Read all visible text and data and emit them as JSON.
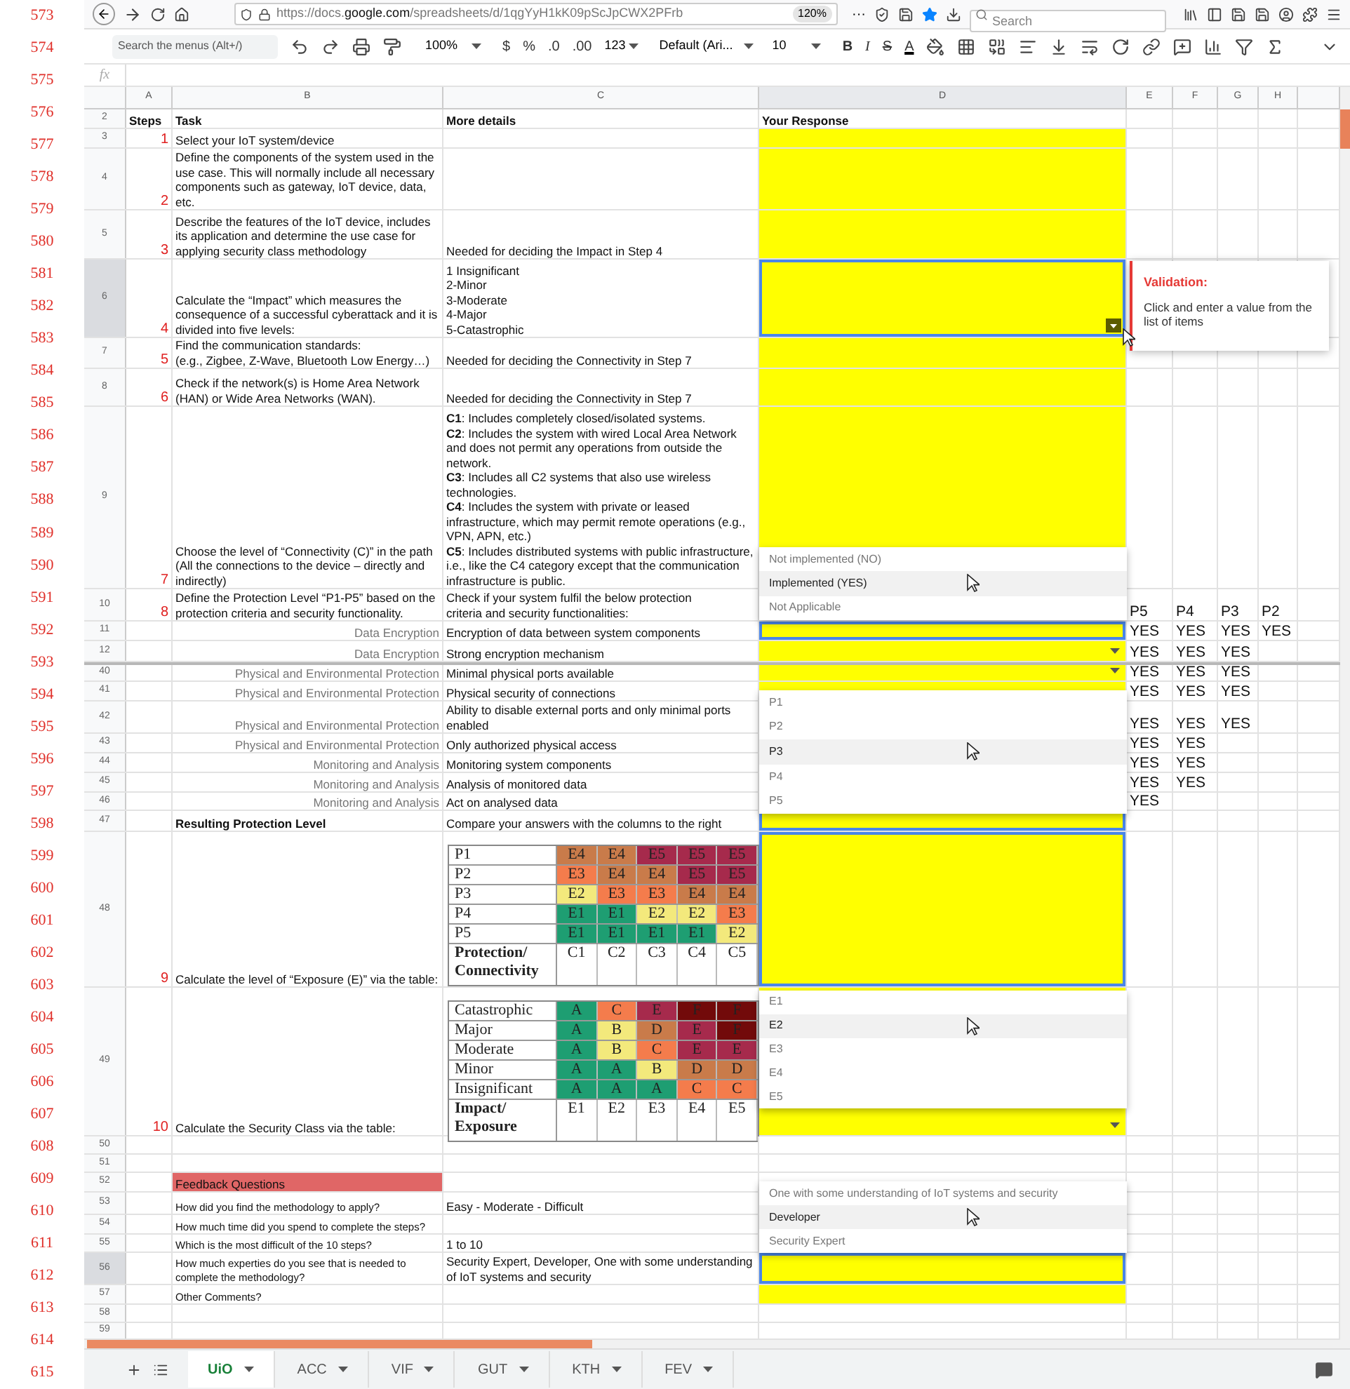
{
  "page_numbers": [
    "573",
    "574",
    "575",
    "576",
    "577",
    "578",
    "579",
    "580",
    "581",
    "582",
    "583",
    "584",
    "585",
    "586",
    "587",
    "588",
    "589",
    "590",
    "591",
    "592",
    "593",
    "594",
    "595",
    "596",
    "597",
    "598",
    "599",
    "600",
    "601",
    "602",
    "603",
    "604",
    "605",
    "606",
    "607",
    "608",
    "609",
    "610",
    "611",
    "612",
    "613",
    "614",
    "615"
  ],
  "browser": {
    "url_start": "https://docs.",
    "url_domain": "google.com",
    "url_rest": "/spreadsheets/d/1qgYyH1kK09pScJpCWX2PFrb",
    "zoom": "120%",
    "more": "···",
    "search": {
      "placeholder": "Search"
    }
  },
  "toolbar": {
    "menu_search": {
      "placeholder": "Search the menus (Alt+/)"
    },
    "zoom": "100%",
    "currency": "$",
    "percent": "%",
    "decimal_less": ".0",
    "decimal_more": ".00",
    "number_format": "123",
    "font": "Default (Ari...",
    "font_size": "10",
    "bold": "B",
    "italic": "I",
    "strike": "S",
    "text_color": "A"
  },
  "formula_bar": {
    "label": "fx"
  },
  "columns": [
    {
      "label": "A",
      "selected": false
    },
    {
      "label": "B",
      "selected": false
    },
    {
      "label": "C",
      "selected": false
    },
    {
      "label": "D",
      "selected": true
    },
    {
      "label": "E",
      "selected": false
    },
    {
      "label": "F",
      "selected": false
    },
    {
      "label": "G",
      "selected": false
    },
    {
      "label": "H",
      "selected": false
    }
  ],
  "rows": [
    {
      "num": "2",
      "kind": "header",
      "selected": false,
      "step": "Steps",
      "task": "Task",
      "details": "More details",
      "response": "Your Response",
      "yellow": false,
      "outlined": false
    },
    {
      "num": "3",
      "kind": "step",
      "selected": false,
      "step": "1",
      "task": "Select your IoT system/device",
      "yellow": true,
      "outlined": false
    },
    {
      "num": "4",
      "kind": "step",
      "selected": false,
      "step": "2",
      "task": "Define the components of the system used in the use case. This will normally include all necessary components such as gateway, IoT device, data, etc.",
      "yellow": true,
      "outlined": false
    },
    {
      "num": "5",
      "kind": "step",
      "selected": false,
      "step": "3",
      "task": "Describe the features of the IoT device, includes its application and determine the use case for applying security class methodology",
      "details": "Needed for deciding the Impact in Step 4",
      "yellow": true,
      "outlined": false
    },
    {
      "num": "6",
      "kind": "step",
      "selected": true,
      "step": "4",
      "task": "Calculate the “Impact” which measures the consequence of a successful cyberattack and it is divided into five levels:",
      "details": "1 Insignificant\n2-Minor\n3-Moderate\n4-Major\n5-Catastrophic",
      "yellow": true,
      "outlined": true,
      "arrow": true,
      "arrow_hovered": true
    },
    {
      "num": "7",
      "kind": "step",
      "selected": false,
      "step": "5",
      "task": "Find the communication standards:\n(e.g., Zigbee, Z-Wave, Bluetooth Low Energy…)",
      "details": "Needed for deciding the Connectivity in Step 7",
      "yellow": true,
      "outlined": false
    },
    {
      "num": "8",
      "kind": "step",
      "selected": false,
      "step": "6",
      "task": "Check if the network(s) is Home Area Network (HAN) or Wide Area Networks (WAN).",
      "details": "Needed for deciding the Connectivity in Step 7",
      "yellow": true,
      "outlined": false
    },
    {
      "num": "9",
      "kind": "step",
      "selected": false,
      "step": "7",
      "task": "Choose the level of “Connectivity (C)” in the path (All the connections to the device – directly and indirectly)",
      "details": "**C1**: Includes completely closed/isolated systems.\n**C2**: Includes the system with wired Local Area Network and does not permit any operations from outside the network.\n**C3**: Includes all C2 systems that also use wireless technologies.\n**C4**: Includes the system with private or leased infrastructure, which may permit remote operations (e.g., VPN, APN, etc.)\n**C5**: Includes distributed systems with public infrastructure, i.e., like the C4 category except that the communication infrastructure is public.",
      "yellow": true,
      "outlined": false
    },
    {
      "num": "10",
      "kind": "step",
      "selected": false,
      "step": "8",
      "task": "Define the Protection Level “P1-P5” based on the protection criteria and security functionality.",
      "details": "Check if your system fulfil the below protection\n criteria and security functionalities:",
      "marks": [
        "P5",
        "P4",
        "P3",
        "P2"
      ]
    },
    {
      "num": "11",
      "kind": "criteria",
      "selected": false,
      "task": "Data Encryption",
      "details": "Encryption of data between system components",
      "yellow": true,
      "outlined": true,
      "marks": [
        "YES",
        "YES",
        "YES",
        "YES"
      ]
    },
    {
      "num": "12",
      "kind": "criteria",
      "selected": false,
      "task": "Data Encryption",
      "details": "Strong encryption mechanism",
      "yellow": true,
      "outlined": false,
      "arrow": true,
      "arrow_hovered": false,
      "marks": [
        "YES",
        "YES",
        "YES"
      ]
    },
    {
      "num": "40",
      "kind": "criteria",
      "selected": false,
      "after_hidden_rows": true,
      "task": "Physical and Environmental Protection",
      "details": "Minimal physical ports available",
      "yellow": true,
      "outlined": false,
      "arrow": true,
      "arrow_hovered": false,
      "marks": [
        "YES",
        "YES",
        "YES"
      ]
    },
    {
      "num": "41",
      "kind": "criteria",
      "selected": false,
      "task": "Physical and Environmental Protection",
      "details": "Physical security of connections",
      "yellow": true,
      "outlined": false,
      "marks": [
        "YES",
        "YES",
        "YES"
      ]
    },
    {
      "num": "42",
      "kind": "criteria",
      "selected": false,
      "task": "Physical and Environmental Protection",
      "details": "Ability to disable external ports and only minimal ports enabled",
      "marks": [
        "YES",
        "YES",
        "YES"
      ]
    },
    {
      "num": "43",
      "kind": "criteria",
      "selected": false,
      "task": "Physical and Environmental Protection",
      "details": "Only authorized physical access",
      "marks": [
        "YES",
        "YES"
      ]
    },
    {
      "num": "44",
      "kind": "criteria",
      "selected": false,
      "task": "Monitoring and Analysis",
      "details": "Monitoring system components",
      "marks": [
        "YES",
        "YES"
      ]
    },
    {
      "num": "45",
      "kind": "criteria",
      "selected": false,
      "task": "Monitoring and Analysis",
      "details": "Analysis of monitored data",
      "marks": [
        "YES",
        "YES"
      ]
    },
    {
      "num": "46",
      "kind": "criteria",
      "selected": false,
      "task": "Monitoring and Analysis",
      "details": "Act on analysed data",
      "marks": [
        "YES"
      ]
    },
    {
      "num": "47",
      "kind": "result",
      "selected": false,
      "task": "Resulting Protection Level",
      "details": "Compare your answers with the columns to the right",
      "yellow": true,
      "outlined": true
    },
    {
      "num": "48",
      "kind": "image",
      "selected": false,
      "step": "9",
      "task": "Calculate the level of “Exposure (E)” via the table:",
      "yellow": true,
      "outlined": true,
      "table": {
        "rows": [
          {
            "label": "P1",
            "cells": [
              {
                "text": "E4",
                "color": "#c97b4a"
              },
              {
                "text": "E4",
                "color": "#c97b4a"
              },
              {
                "text": "E5",
                "color": "#a62a4c"
              },
              {
                "text": "E5",
                "color": "#a62a4c"
              },
              {
                "text": "E5",
                "color": "#a62a4c"
              }
            ]
          },
          {
            "label": "P2",
            "cells": [
              {
                "text": "E3",
                "color": "#f47c4c"
              },
              {
                "text": "E4",
                "color": "#c97b4a"
              },
              {
                "text": "E4",
                "color": "#c97b4a"
              },
              {
                "text": "E5",
                "color": "#a62a4c"
              },
              {
                "text": "E5",
                "color": "#a62a4c"
              }
            ]
          },
          {
            "label": "P3",
            "cells": [
              {
                "text": "E2",
                "color": "#f3e97c"
              },
              {
                "text": "E3",
                "color": "#f47c4c"
              },
              {
                "text": "E3",
                "color": "#f47c4c"
              },
              {
                "text": "E4",
                "color": "#c97b4a"
              },
              {
                "text": "E4",
                "color": "#c97b4a"
              }
            ]
          },
          {
            "label": "P4",
            "cells": [
              {
                "text": "E1",
                "color": "#1e9e72"
              },
              {
                "text": "E1",
                "color": "#1e9e72"
              },
              {
                "text": "E2",
                "color": "#f3e97c"
              },
              {
                "text": "E2",
                "color": "#f3e97c"
              },
              {
                "text": "E3",
                "color": "#f47c4c"
              }
            ]
          },
          {
            "label": "P5",
            "cells": [
              {
                "text": "E1",
                "color": "#1e9e72"
              },
              {
                "text": "E1",
                "color": "#1e9e72"
              },
              {
                "text": "E1",
                "color": "#1e9e72"
              },
              {
                "text": "E1",
                "color": "#1e9e72"
              },
              {
                "text": "E2",
                "color": "#f3e97c"
              }
            ]
          }
        ],
        "footer_label": "Protection/\nConnectivity",
        "footer": [
          "C1",
          "C2",
          "C3",
          "C4",
          "C5"
        ]
      }
    },
    {
      "num": "49",
      "kind": "image",
      "selected": false,
      "step": "10",
      "task": "Calculate the Security Class via the table:",
      "yellow": true,
      "outlined": false,
      "arrow": true,
      "arrow_hovered": false,
      "table": {
        "rows": [
          {
            "label": "Catastrophic",
            "cells": [
              {
                "text": "A",
                "color": "#1e9e72"
              },
              {
                "text": "C",
                "color": "#f47c4c"
              },
              {
                "text": "E",
                "color": "#a62a4c"
              },
              {
                "text": "F",
                "color": "#720a0a"
              },
              {
                "text": "F",
                "color": "#720a0a"
              }
            ]
          },
          {
            "label": "Major",
            "cells": [
              {
                "text": "A",
                "color": "#1e9e72"
              },
              {
                "text": "B",
                "color": "#f3e97c"
              },
              {
                "text": "D",
                "color": "#c97b4a"
              },
              {
                "text": "E",
                "color": "#a62a4c"
              },
              {
                "text": "F",
                "color": "#720a0a"
              }
            ]
          },
          {
            "label": "Moderate",
            "cells": [
              {
                "text": "A",
                "color": "#1e9e72"
              },
              {
                "text": "B",
                "color": "#f3e97c"
              },
              {
                "text": "C",
                "color": "#f47c4c"
              },
              {
                "text": "E",
                "color": "#a62a4c"
              },
              {
                "text": "E",
                "color": "#a62a4c"
              }
            ]
          },
          {
            "label": "Minor",
            "cells": [
              {
                "text": "A",
                "color": "#1e9e72"
              },
              {
                "text": "A",
                "color": "#1e9e72"
              },
              {
                "text": "B",
                "color": "#f3e97c"
              },
              {
                "text": "D",
                "color": "#c97b4a"
              },
              {
                "text": "D",
                "color": "#c97b4a"
              }
            ]
          },
          {
            "label": "Insignificant",
            "cells": [
              {
                "text": "A",
                "color": "#1e9e72"
              },
              {
                "text": "A",
                "color": "#1e9e72"
              },
              {
                "text": "A",
                "color": "#1e9e72"
              },
              {
                "text": "C",
                "color": "#f47c4c"
              },
              {
                "text": "C",
                "color": "#f47c4c"
              }
            ]
          }
        ],
        "footer_label": "Impact/\nExposure",
        "footer": [
          "E1",
          "E2",
          "E3",
          "E4",
          "E5"
        ]
      }
    },
    {
      "num": "50",
      "kind": "blank",
      "selected": false,
      "yellow": false,
      "outlined": false
    },
    {
      "num": "51",
      "kind": "blank",
      "selected": false,
      "yellow": false,
      "outlined": false
    },
    {
      "num": "52",
      "kind": "feedback_title",
      "selected": false,
      "task": "Feedback Questions",
      "yellow": false,
      "outlined": false
    },
    {
      "num": "53",
      "kind": "question",
      "selected": false,
      "task": "How did you find the methodology to apply?",
      "details": "Easy - Moderate - Difficult"
    },
    {
      "num": "54",
      "kind": "question",
      "selected": false,
      "task": "How much time did you spend to complete the steps?"
    },
    {
      "num": "55",
      "kind": "question",
      "selected": false,
      "task": "Which is the most difficult of the 10 steps?",
      "details": "1 to 10"
    },
    {
      "num": "56",
      "kind": "question",
      "selected": true,
      "task": "How much experties do you see that is needed to complete the methodology?",
      "details": "Security Expert, Developer, One with some understanding of IoT systems and security",
      "yellow": true,
      "outlined": true
    },
    {
      "num": "57",
      "kind": "question",
      "selected": false,
      "task": "Other Comments?",
      "yellow": true,
      "outlined": false
    },
    {
      "num": "58",
      "kind": "blank",
      "selected": false,
      "yellow": false,
      "outlined": false
    },
    {
      "num": "59",
      "kind": "blank",
      "selected": false,
      "yellow": false,
      "outlined": false
    }
  ],
  "validation": {
    "title": "Validation:",
    "message": "Click and enter a value from the list of items"
  },
  "dropdowns": [
    {
      "items": [
        {
          "label": "Not implemented (NO)",
          "selected": false
        },
        {
          "label": "Implemented (YES)",
          "selected": true
        },
        {
          "label": "Not Applicable",
          "selected": false
        }
      ]
    },
    {
      "items": [
        {
          "label": "P1",
          "selected": false
        },
        {
          "label": "P2",
          "selected": false
        },
        {
          "label": "P3",
          "selected": true
        },
        {
          "label": "P4",
          "selected": false
        },
        {
          "label": "P5",
          "selected": false
        }
      ]
    },
    {
      "items": [
        {
          "label": "E1",
          "selected": false
        },
        {
          "label": "E2",
          "selected": true
        },
        {
          "label": "E3",
          "selected": false
        },
        {
          "label": "E4",
          "selected": false
        },
        {
          "label": "E5",
          "selected": false
        }
      ]
    },
    {
      "items": [
        {
          "label": "One with some understanding of IoT systems and security",
          "selected": false
        },
        {
          "label": "Developer",
          "selected": true
        },
        {
          "label": "Security Expert",
          "selected": false
        }
      ]
    }
  ],
  "sheet_tabs": [
    {
      "label": "UiO",
      "selected": true
    },
    {
      "label": "ACC",
      "selected": false
    },
    {
      "label": "VIF",
      "selected": false
    },
    {
      "label": "GUT",
      "selected": false
    },
    {
      "label": "KTH",
      "selected": false
    },
    {
      "label": "FEV",
      "selected": false
    }
  ]
}
